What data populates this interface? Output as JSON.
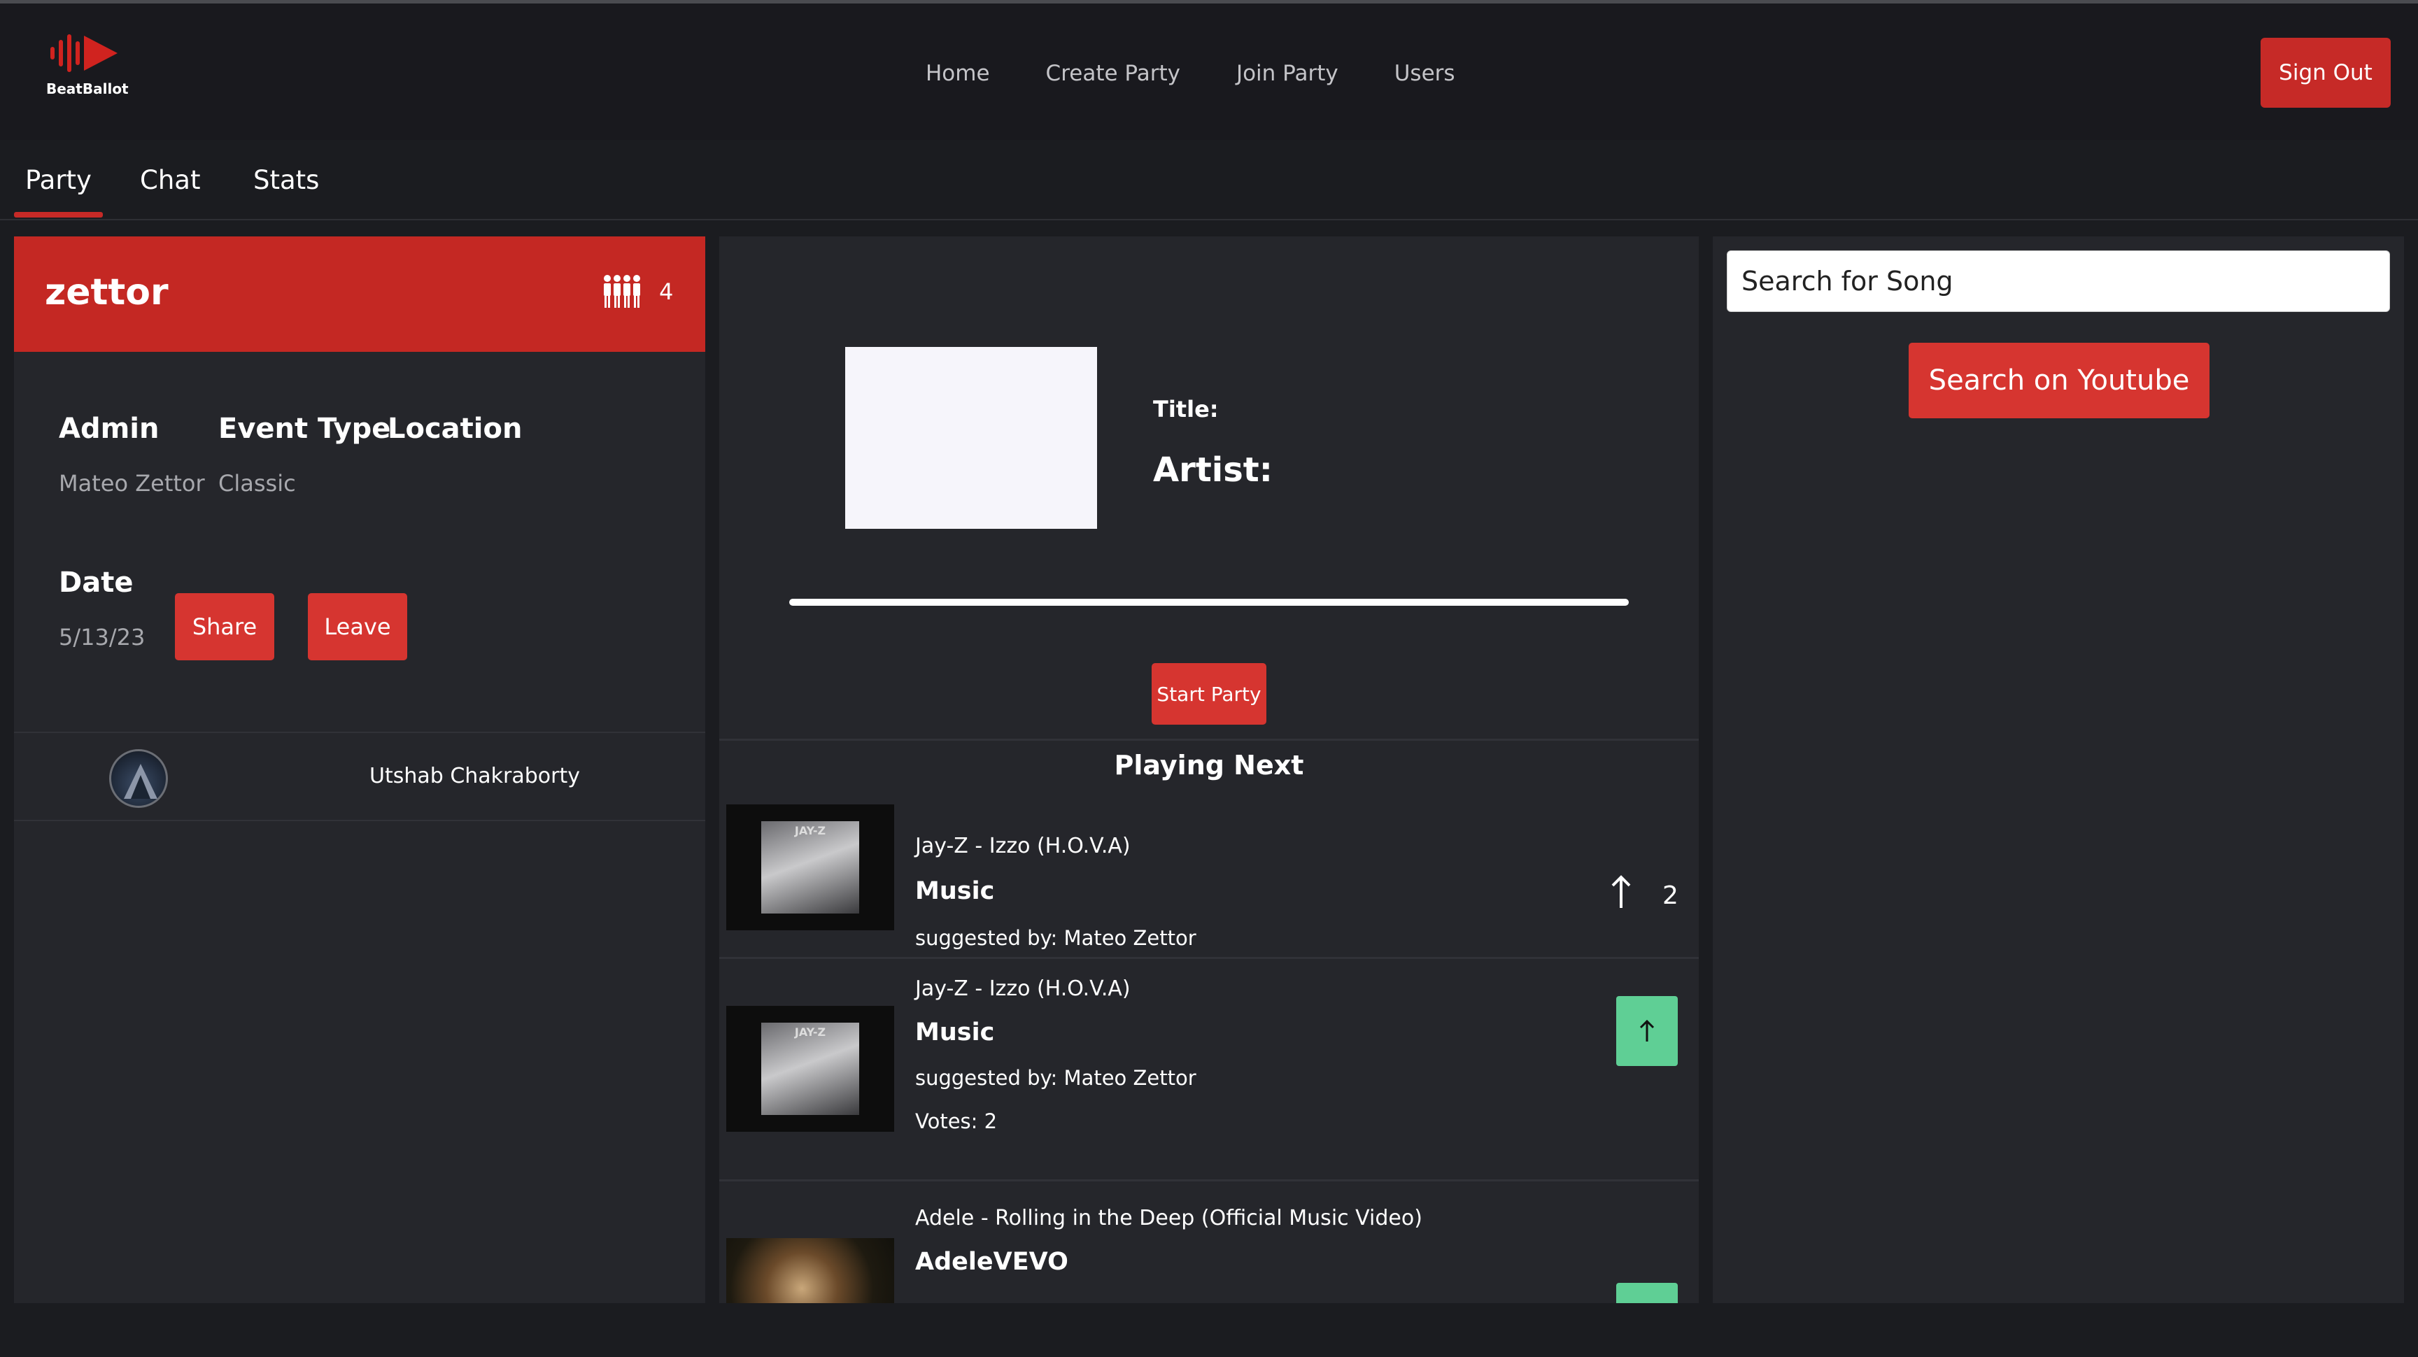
{
  "app": {
    "logo_text": "BeatBallot",
    "brand_color": "#c62a27"
  },
  "nav": {
    "links": [
      "Home",
      "Create Party",
      "Join Party",
      "Users"
    ],
    "sign_out": "Sign Out"
  },
  "tabs": {
    "items": [
      "Party",
      "Chat",
      "Stats"
    ],
    "active": "Party"
  },
  "party": {
    "name": "zettor",
    "member_count": "4",
    "admin_label": "Admin",
    "admin_value": "Mateo Zettor",
    "event_type_label": "Event Type",
    "event_type_value": "Classic",
    "location_label": "Location",
    "date_label": "Date",
    "date_value": "5/13/23",
    "share_label": "Share",
    "leave_label": "Leave",
    "members": [
      "Utshab Chakraborty"
    ]
  },
  "now_playing": {
    "title_label": "Title:",
    "artist_label": "Artist:",
    "start_label": "Start Party",
    "progress": 1.0
  },
  "queue": {
    "heading": "Playing Next",
    "items": [
      {
        "title": "Jay-Z - Izzo (H.O.V.A)",
        "channel": "Music",
        "suggested_by": "suggested by: Mateo Zettor",
        "votes": "2",
        "thumb_label": "JAY-Z"
      },
      {
        "title": "Jay-Z - Izzo (H.O.V.A)",
        "channel": "Music",
        "suggested_by": "suggested by: Mateo Zettor",
        "votes_text": "Votes: 2",
        "thumb_label": "JAY-Z"
      },
      {
        "title": "Adele - Rolling in the Deep (Official Music Video)",
        "channel": "AdeleVEVO"
      }
    ]
  },
  "search": {
    "placeholder": "Search for Song",
    "button_label": "Search on Youtube"
  }
}
